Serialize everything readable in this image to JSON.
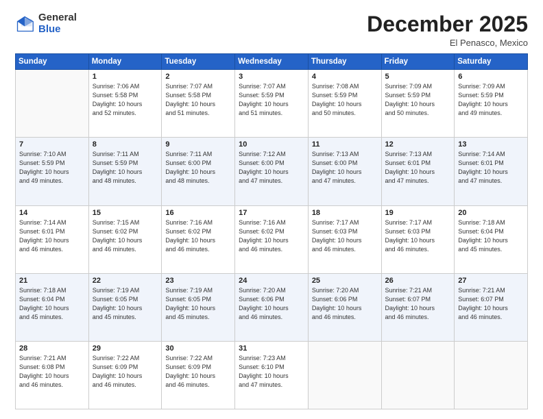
{
  "logo": {
    "general": "General",
    "blue": "Blue"
  },
  "header": {
    "month": "December 2025",
    "location": "El Penasco, Mexico"
  },
  "weekdays": [
    "Sunday",
    "Monday",
    "Tuesday",
    "Wednesday",
    "Thursday",
    "Friday",
    "Saturday"
  ],
  "rows": [
    [
      {
        "day": "",
        "info": ""
      },
      {
        "day": "1",
        "info": "Sunrise: 7:06 AM\nSunset: 5:58 PM\nDaylight: 10 hours\nand 52 minutes."
      },
      {
        "day": "2",
        "info": "Sunrise: 7:07 AM\nSunset: 5:58 PM\nDaylight: 10 hours\nand 51 minutes."
      },
      {
        "day": "3",
        "info": "Sunrise: 7:07 AM\nSunset: 5:59 PM\nDaylight: 10 hours\nand 51 minutes."
      },
      {
        "day": "4",
        "info": "Sunrise: 7:08 AM\nSunset: 5:59 PM\nDaylight: 10 hours\nand 50 minutes."
      },
      {
        "day": "5",
        "info": "Sunrise: 7:09 AM\nSunset: 5:59 PM\nDaylight: 10 hours\nand 50 minutes."
      },
      {
        "day": "6",
        "info": "Sunrise: 7:09 AM\nSunset: 5:59 PM\nDaylight: 10 hours\nand 49 minutes."
      }
    ],
    [
      {
        "day": "7",
        "info": "Sunrise: 7:10 AM\nSunset: 5:59 PM\nDaylight: 10 hours\nand 49 minutes."
      },
      {
        "day": "8",
        "info": "Sunrise: 7:11 AM\nSunset: 5:59 PM\nDaylight: 10 hours\nand 48 minutes."
      },
      {
        "day": "9",
        "info": "Sunrise: 7:11 AM\nSunset: 6:00 PM\nDaylight: 10 hours\nand 48 minutes."
      },
      {
        "day": "10",
        "info": "Sunrise: 7:12 AM\nSunset: 6:00 PM\nDaylight: 10 hours\nand 47 minutes."
      },
      {
        "day": "11",
        "info": "Sunrise: 7:13 AM\nSunset: 6:00 PM\nDaylight: 10 hours\nand 47 minutes."
      },
      {
        "day": "12",
        "info": "Sunrise: 7:13 AM\nSunset: 6:01 PM\nDaylight: 10 hours\nand 47 minutes."
      },
      {
        "day": "13",
        "info": "Sunrise: 7:14 AM\nSunset: 6:01 PM\nDaylight: 10 hours\nand 47 minutes."
      }
    ],
    [
      {
        "day": "14",
        "info": "Sunrise: 7:14 AM\nSunset: 6:01 PM\nDaylight: 10 hours\nand 46 minutes."
      },
      {
        "day": "15",
        "info": "Sunrise: 7:15 AM\nSunset: 6:02 PM\nDaylight: 10 hours\nand 46 minutes."
      },
      {
        "day": "16",
        "info": "Sunrise: 7:16 AM\nSunset: 6:02 PM\nDaylight: 10 hours\nand 46 minutes."
      },
      {
        "day": "17",
        "info": "Sunrise: 7:16 AM\nSunset: 6:02 PM\nDaylight: 10 hours\nand 46 minutes."
      },
      {
        "day": "18",
        "info": "Sunrise: 7:17 AM\nSunset: 6:03 PM\nDaylight: 10 hours\nand 46 minutes."
      },
      {
        "day": "19",
        "info": "Sunrise: 7:17 AM\nSunset: 6:03 PM\nDaylight: 10 hours\nand 46 minutes."
      },
      {
        "day": "20",
        "info": "Sunrise: 7:18 AM\nSunset: 6:04 PM\nDaylight: 10 hours\nand 45 minutes."
      }
    ],
    [
      {
        "day": "21",
        "info": "Sunrise: 7:18 AM\nSunset: 6:04 PM\nDaylight: 10 hours\nand 45 minutes."
      },
      {
        "day": "22",
        "info": "Sunrise: 7:19 AM\nSunset: 6:05 PM\nDaylight: 10 hours\nand 45 minutes."
      },
      {
        "day": "23",
        "info": "Sunrise: 7:19 AM\nSunset: 6:05 PM\nDaylight: 10 hours\nand 45 minutes."
      },
      {
        "day": "24",
        "info": "Sunrise: 7:20 AM\nSunset: 6:06 PM\nDaylight: 10 hours\nand 46 minutes."
      },
      {
        "day": "25",
        "info": "Sunrise: 7:20 AM\nSunset: 6:06 PM\nDaylight: 10 hours\nand 46 minutes."
      },
      {
        "day": "26",
        "info": "Sunrise: 7:21 AM\nSunset: 6:07 PM\nDaylight: 10 hours\nand 46 minutes."
      },
      {
        "day": "27",
        "info": "Sunrise: 7:21 AM\nSunset: 6:07 PM\nDaylight: 10 hours\nand 46 minutes."
      }
    ],
    [
      {
        "day": "28",
        "info": "Sunrise: 7:21 AM\nSunset: 6:08 PM\nDaylight: 10 hours\nand 46 minutes."
      },
      {
        "day": "29",
        "info": "Sunrise: 7:22 AM\nSunset: 6:09 PM\nDaylight: 10 hours\nand 46 minutes."
      },
      {
        "day": "30",
        "info": "Sunrise: 7:22 AM\nSunset: 6:09 PM\nDaylight: 10 hours\nand 46 minutes."
      },
      {
        "day": "31",
        "info": "Sunrise: 7:23 AM\nSunset: 6:10 PM\nDaylight: 10 hours\nand 47 minutes."
      },
      {
        "day": "",
        "info": ""
      },
      {
        "day": "",
        "info": ""
      },
      {
        "day": "",
        "info": ""
      }
    ]
  ]
}
